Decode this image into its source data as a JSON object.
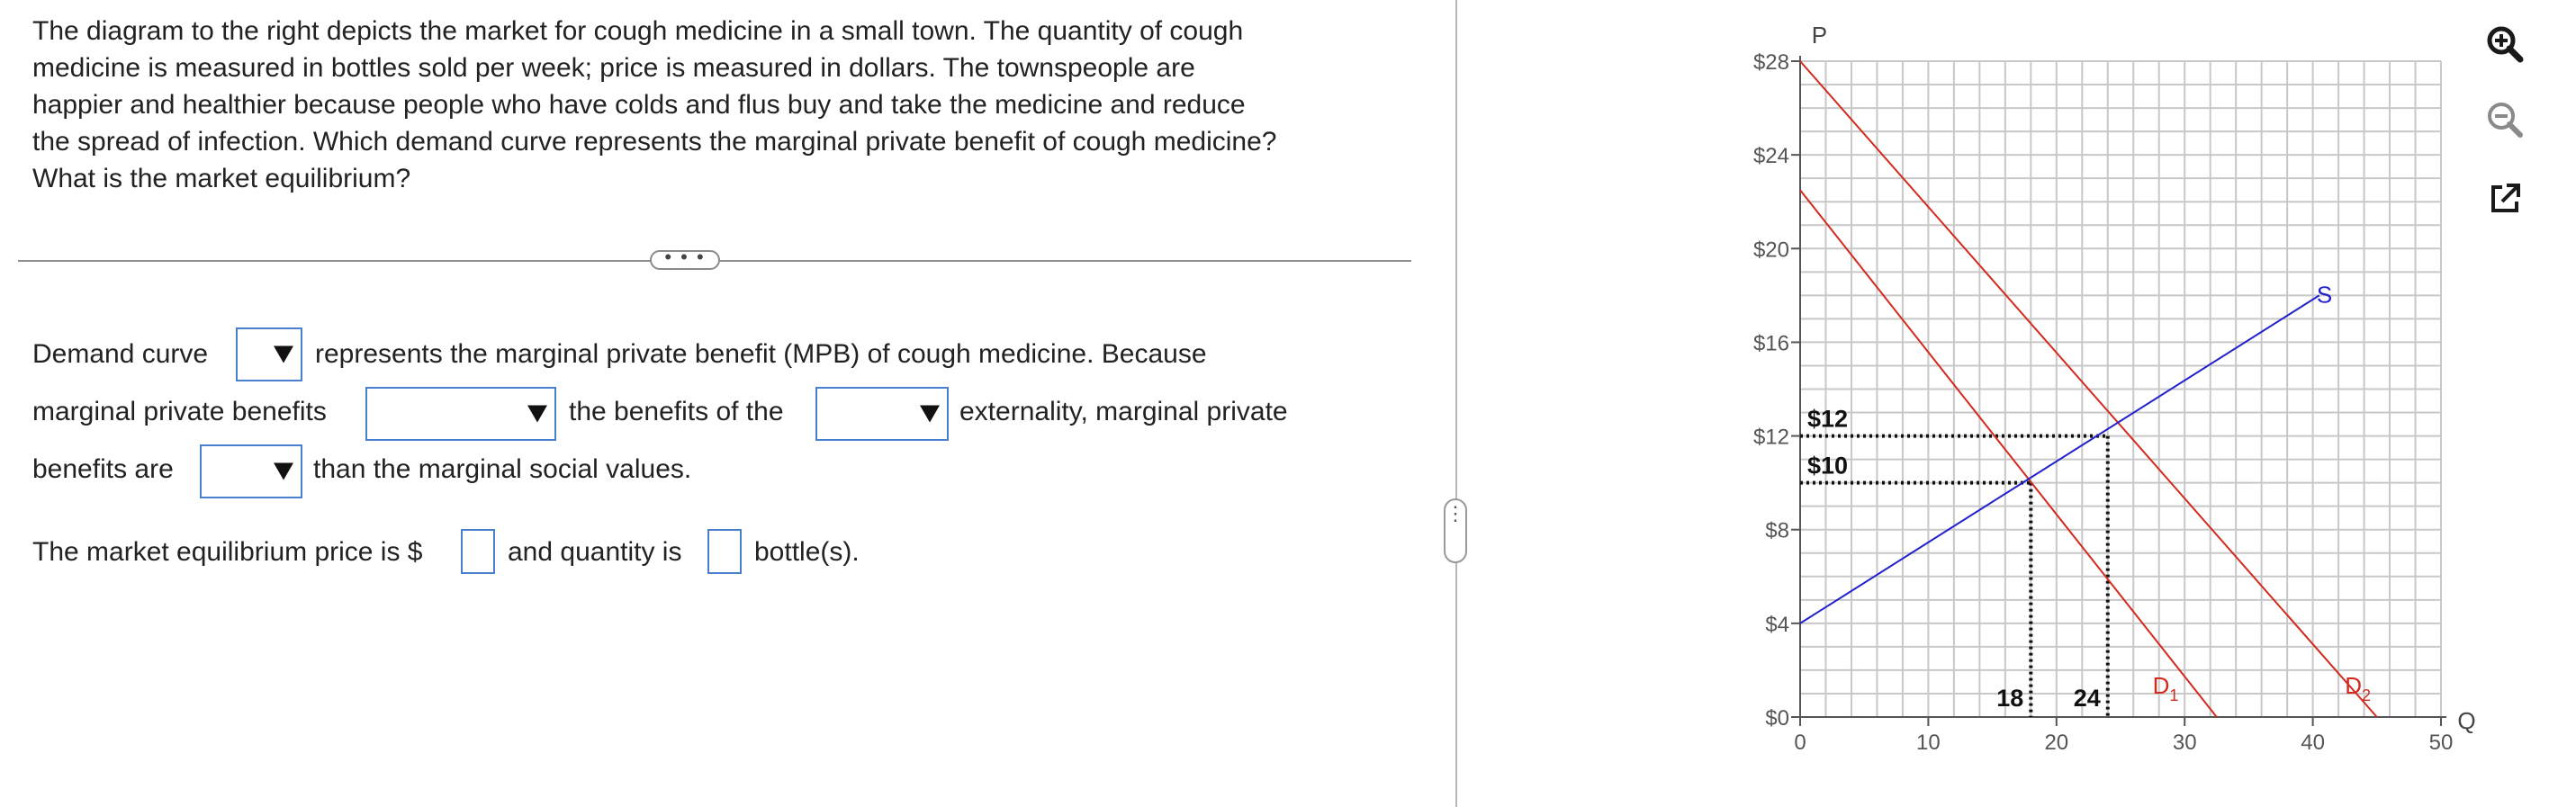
{
  "question": {
    "lines": [
      "The diagram to the right depicts the market for cough medicine in a small town. The quantity of cough",
      "medicine is measured in bottles sold per week; price is measured in dollars. The townspeople are",
      "happier and healthier because people who have colds and flus buy and take the medicine and reduce",
      "the spread of infection. Which demand curve represents the marginal private benefit of cough medicine?",
      "What is the market equilibrium?"
    ]
  },
  "more_button_label": "• • •",
  "answer": {
    "line1_prefix": "Demand curve",
    "line1_suffix": "represents the marginal private benefit (MPB) of cough medicine. Because",
    "line2_prefix": "marginal private benefits",
    "line2_middle": "the benefits of the",
    "line2_suffix": "externality, marginal private",
    "line3_prefix": "benefits are",
    "line3_suffix": "than the marginal social values.",
    "line4_prefix": "The market equilibrium price is $",
    "line4_middle": "and quantity is",
    "line4_suffix": "bottle(s).",
    "dropdown_demand_curve": "",
    "dropdown_compare": "",
    "dropdown_externality": "",
    "dropdown_greater_less": "",
    "price_input": "",
    "quantity_input": ""
  },
  "splitter_handle": "⋮",
  "chart_data": {
    "type": "line",
    "xlabel": "Q",
    "ylabel": "P",
    "xlim": [
      0,
      50
    ],
    "ylim": [
      0,
      28
    ],
    "x_ticks": [
      0,
      10,
      20,
      30,
      40,
      50
    ],
    "y_ticks": [
      "$0",
      "$4",
      "$8",
      "$12",
      "$16",
      "$20",
      "$24",
      "$28"
    ],
    "y_tick_values": [
      0,
      4,
      8,
      12,
      16,
      20,
      24,
      28
    ],
    "grid": true,
    "series": [
      {
        "name": "D1",
        "color": "#d32a1e",
        "x": [
          0,
          32.5
        ],
        "y": [
          22.5,
          0
        ]
      },
      {
        "name": "D2",
        "color": "#d32a1e",
        "x": [
          0,
          45
        ],
        "y": [
          28,
          0
        ]
      },
      {
        "name": "S",
        "color": "#2222cc",
        "x": [
          0,
          40.5
        ],
        "y": [
          4,
          18
        ]
      }
    ],
    "curve_labels": {
      "D1": "D",
      "D1_sub": "1",
      "D2": "D",
      "D2_sub": "2",
      "S": "S"
    },
    "guide_lines": [
      {
        "price": 12,
        "quantity": 24,
        "price_label": "$12",
        "quantity_label": "24"
      },
      {
        "price": 10,
        "quantity": 18,
        "price_label": "$10",
        "quantity_label": "18"
      }
    ]
  },
  "toolbar": {
    "zoom_in_icon": "zoom-in-icon",
    "zoom_out_icon": "zoom-out-icon",
    "popout_icon": "external-link-icon"
  }
}
